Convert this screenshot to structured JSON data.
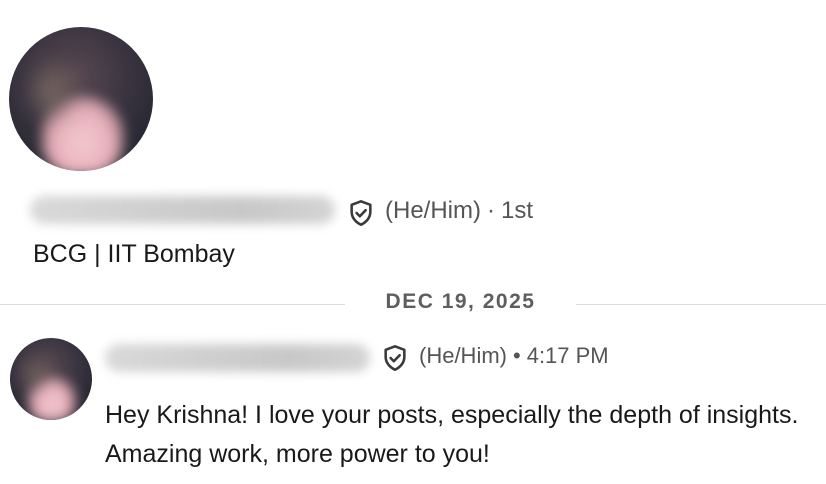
{
  "profile": {
    "pronouns": "(He/Him)",
    "connection_degree": "1st",
    "headline": "BCG | IIT Bombay"
  },
  "conversation": {
    "date_divider": "DEC 19, 2025",
    "message": {
      "pronouns": "(He/Him)",
      "time": "4:17 PM",
      "text": "Hey Krishna! I love your posts, especially the depth of insights. Amazing work, more power to you!"
    }
  },
  "icons": {
    "verified": "shield-check-icon"
  },
  "colors": {
    "text_primary": "#191919",
    "text_secondary": "#555555",
    "divider": "#dcdcdc"
  }
}
